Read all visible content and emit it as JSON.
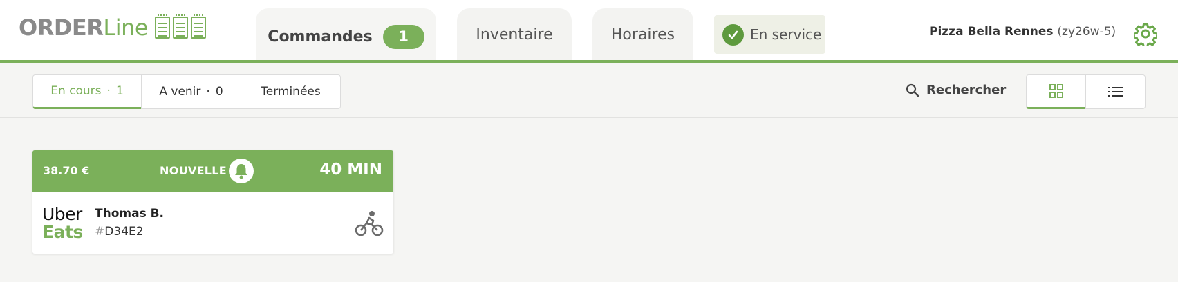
{
  "app": {
    "logo_bold": "ORDER",
    "logo_light": "Line"
  },
  "nav": {
    "tabs": [
      {
        "label": "Commandes",
        "badge": "1",
        "active": true
      },
      {
        "label": "Inventaire",
        "active": false
      },
      {
        "label": "Horaires",
        "active": false
      }
    ],
    "service_status": "En service",
    "restaurant_name": "Pizza Bella Rennes",
    "restaurant_code": "(zy26w-5)"
  },
  "filters": {
    "segments": [
      {
        "label": "En cours",
        "count": "1",
        "active": true
      },
      {
        "label": "A venir",
        "count": "0",
        "active": false
      },
      {
        "label": "Terminées",
        "active": false
      }
    ],
    "search_label": "Rechercher",
    "view_modes": [
      "grid-icon",
      "list-icon"
    ],
    "active_view": "grid"
  },
  "orders": [
    {
      "price": "38.70 €",
      "status": "NOUVELLE",
      "eta": "40 MIN",
      "platform_line1": "Uber",
      "platform_line2": "Eats",
      "customer": "Thomas B.",
      "order_hash": "#",
      "order_id": "D34E2",
      "delivery_icon": "bike-icon"
    }
  ],
  "colors": {
    "accent": "#7bb05a",
    "accent_dark": "#5e9a3e",
    "background": "#f5f5f3"
  }
}
